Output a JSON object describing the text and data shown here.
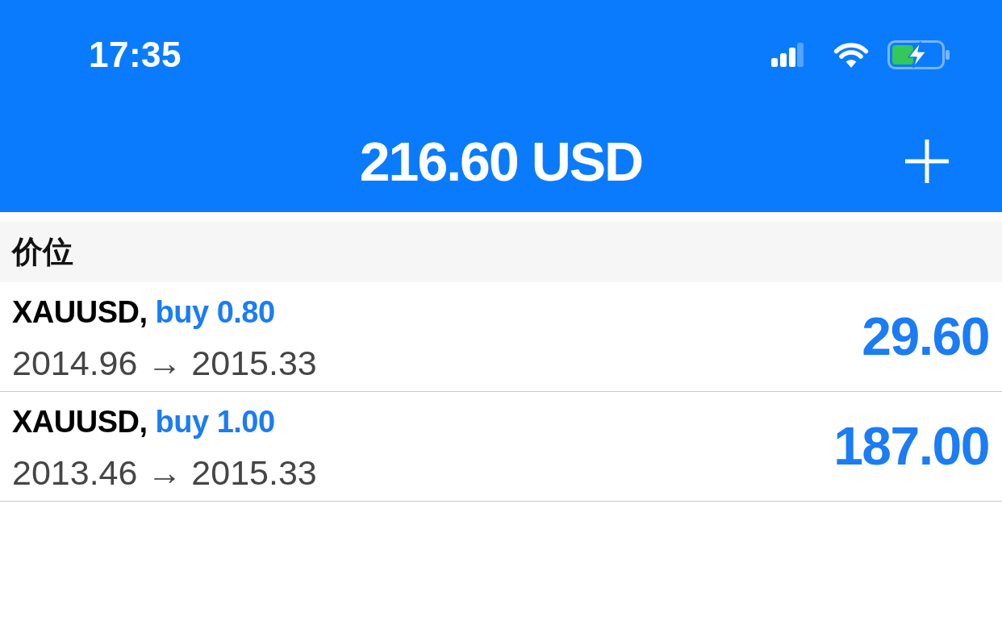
{
  "status_bar": {
    "time": "17:35"
  },
  "header": {
    "title": "216.60 USD"
  },
  "section": {
    "title": "价位"
  },
  "positions": [
    {
      "symbol": "XAUUSD,",
      "order": "buy 0.80",
      "prices": "2014.96 → 2015.33",
      "profit": "29.60"
    },
    {
      "symbol": "XAUUSD,",
      "order": "buy 1.00",
      "prices": "2013.46 → 2015.33",
      "profit": "187.00"
    }
  ]
}
